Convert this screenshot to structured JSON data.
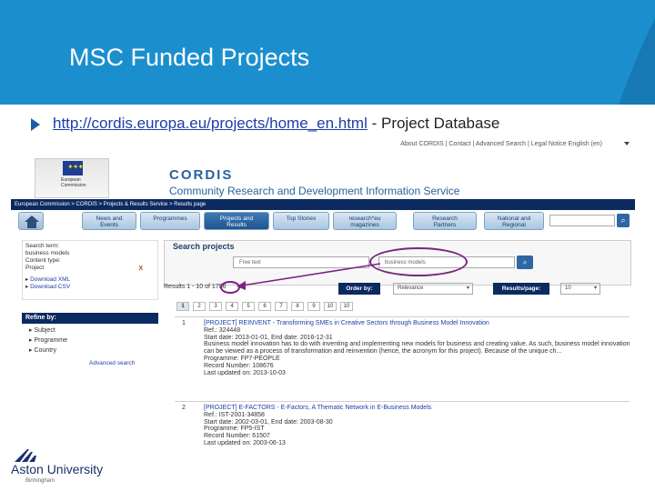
{
  "slide": {
    "title": "MSC Funded Projects",
    "bullet_link": "http://cordis.europa.eu/projects/home_en.html",
    "bullet_suffix": " - Project Database"
  },
  "site": {
    "top_links": "About CORDIS | Contact | Advanced Search | Legal Notice   English (en)",
    "ec_logo_text": "European\nCommission",
    "brand": "CORDIS",
    "tagline": "Community Research and Development Information Service",
    "breadcrumb": "European Commission  >  CORDIS  >  Projects & Results Service  >  Results page"
  },
  "nav": {
    "tabs": [
      {
        "label": "News and\nEvents",
        "active": false
      },
      {
        "label": "Programmes",
        "active": false
      },
      {
        "label": "Projects and\nResults",
        "active": true
      },
      {
        "label": "Top Stories",
        "active": false
      },
      {
        "label": "research*eu\nmagazines",
        "active": false
      },
      {
        "label": "Research\nPartners",
        "active": false
      },
      {
        "label": "National and\nRegional",
        "active": false
      }
    ]
  },
  "sidebar": {
    "criteria": {
      "search_term_label": "Search term:",
      "search_term_value": "business models",
      "content_type_label": "Content type:",
      "content_type_value": "Project",
      "remove": "X",
      "download_xml": "Download XML",
      "download_csv": "Download CSV"
    },
    "refine_title": "Refine by:",
    "refine_items": [
      "Subject",
      "Programme",
      "Country"
    ],
    "advanced_search": "Advanced search"
  },
  "search": {
    "title": "Search projects",
    "free_text_placeholder": "Free text",
    "keyword_value": "business models",
    "button": "Q"
  },
  "results": {
    "summary_prefix": "Results 1 - 10",
    "summary_total": "of 1786",
    "order_label": "Order by:",
    "order_value": "Relevance",
    "page_label": "Results/page:",
    "page_value": "10",
    "pages": [
      "1",
      "2",
      "3",
      "4",
      "5",
      "6",
      "7",
      "8",
      "9",
      "10",
      "10"
    ],
    "items": [
      {
        "num": "1",
        "title": "[PROJECT]  REINVENT - Transforming SMEs in Creative Sectors through Business Model Innovation",
        "ref": "Ref.: 324448",
        "dates": "Start date: 2013-01-01, End date: 2016-12-31",
        "desc": "Business model innovation has to do with inventing and implementing new models for business and creating value. As such, business model innovation can be viewed as a process of transformation and reinvention (hence, the acronym for this project). Because of the unique ch...",
        "programme": "Programme: FP7-PEOPLE",
        "record": "Record Number: 108676",
        "updated": "Last updated on: 2013-10-03"
      },
      {
        "num": "2",
        "title": "[PROJECT]  E-FACTORS - E-Factors, A Thematic Network in E-Business Models",
        "ref": "Ref.: IST-2001-34858",
        "dates": "Start date: 2002-03-01, End date: 2003-08-30",
        "desc": "",
        "programme": "Programme: FP5-IST",
        "record": "Record Number: 61507",
        "updated": "Last updated on: 2003-06-13"
      }
    ]
  },
  "footer": {
    "brand": "Aston University",
    "sub": "Birmingham"
  },
  "colors": {
    "header_blue": "#1b8fce",
    "navy": "#0b2a60",
    "highlight_purple": "#7a2580",
    "link_blue": "#1a3fa8"
  }
}
